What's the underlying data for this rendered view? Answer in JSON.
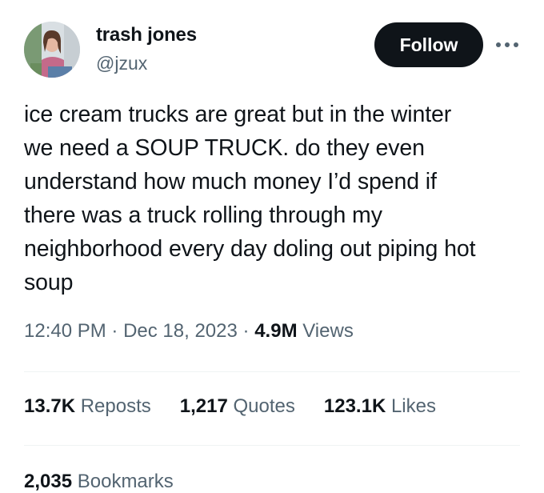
{
  "author": {
    "display_name": "trash jones",
    "handle": "@jzux"
  },
  "follow_label": "Follow",
  "tweet": {
    "text": "ice cream trucks are great but in the winter\nwe need a SOUP TRUCK. do they even\nunderstand how much money I’d spend if\nthere was a truck rolling through my\nneighborhood every day doling out piping hot\nsoup",
    "time": "12:40 PM",
    "separator": "·",
    "date": "Dec 18, 2023",
    "views_count": "4.9M",
    "views_label": "Views"
  },
  "stats": {
    "reposts_count": "13.7K",
    "reposts_label": "Reposts",
    "quotes_count": "1,217",
    "quotes_label": "Quotes",
    "likes_count": "123.1K",
    "likes_label": "Likes",
    "bookmarks_count": "2,035",
    "bookmarks_label": "Bookmarks"
  },
  "colors": {
    "text_primary": "#0f1419",
    "text_secondary": "#536471",
    "button_bg": "#0f1419",
    "divider": "#eff3f4"
  },
  "icons": {
    "more": "more-horizontal-icon"
  }
}
